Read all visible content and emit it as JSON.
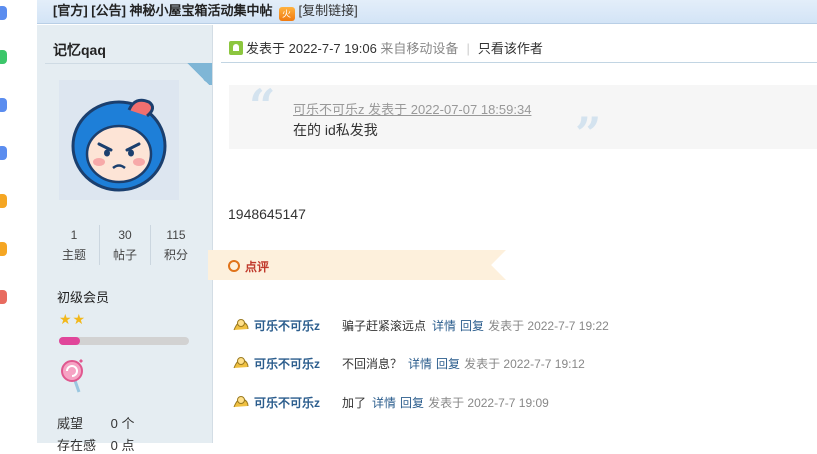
{
  "thread": {
    "title": "[官方] [公告] 神秘小屋宝箱活动集中帖",
    "hot_badge": "火",
    "copy_link": "[复制链接]"
  },
  "author": {
    "name": "记忆qaq",
    "stats": [
      {
        "value": "1",
        "label": "主题"
      },
      {
        "value": "30",
        "label": "帖子"
      },
      {
        "value": "115",
        "label": "积分"
      }
    ],
    "grade": "初级会员",
    "stars": "★★",
    "level_progress": 0.16,
    "prestige_label": "威望",
    "prestige_value": "0 个",
    "presence_label": "存在感",
    "presence_value": "0 点"
  },
  "post": {
    "posted_at": "发表于 2022-7-7 19:06",
    "source": "来自移动设备",
    "only_author": "只看该作者",
    "quote_header": "可乐不可乐z 发表于 2022-07-07 18:59:34",
    "quote_text": "在的 id私发我",
    "body": "1948645147",
    "review_label": "点评"
  },
  "comments": [
    {
      "author": "可乐不可乐z",
      "text": "骗子赶紧滚远点",
      "detail": "详情",
      "reply": "回复",
      "date": "发表于 2022-7-7 19:22"
    },
    {
      "author": "可乐不可乐z",
      "text": "不回消息？",
      "detail": "详情",
      "reply": "回复",
      "date": "发表于 2022-7-7 19:12"
    },
    {
      "author": "可乐不可乐z",
      "text": "加了",
      "detail": "详情",
      "reply": "回复",
      "date": "发表于 2022-7-7 19:09"
    }
  ],
  "colors": {
    "accent_link": "#2b5d8d",
    "sidebar_bg": "#e5edf2",
    "review_bg": "#fdf0dc"
  }
}
